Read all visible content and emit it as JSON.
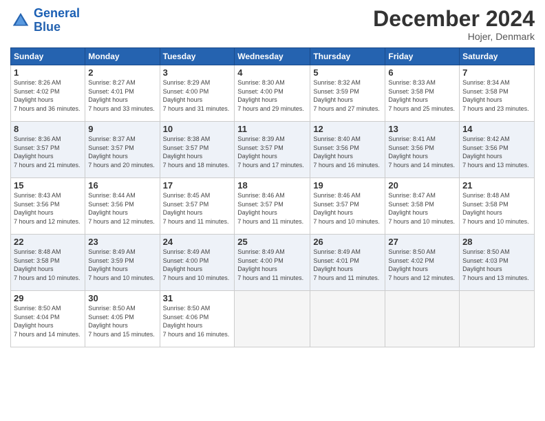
{
  "header": {
    "logo_line1": "General",
    "logo_line2": "Blue",
    "month_year": "December 2024",
    "location": "Hojer, Denmark"
  },
  "days_of_week": [
    "Sunday",
    "Monday",
    "Tuesday",
    "Wednesday",
    "Thursday",
    "Friday",
    "Saturday"
  ],
  "weeks": [
    [
      {
        "day": "1",
        "sunrise": "8:26 AM",
        "sunset": "4:02 PM",
        "daylight": "7 hours and 36 minutes."
      },
      {
        "day": "2",
        "sunrise": "8:27 AM",
        "sunset": "4:01 PM",
        "daylight": "7 hours and 33 minutes."
      },
      {
        "day": "3",
        "sunrise": "8:29 AM",
        "sunset": "4:00 PM",
        "daylight": "7 hours and 31 minutes."
      },
      {
        "day": "4",
        "sunrise": "8:30 AM",
        "sunset": "4:00 PM",
        "daylight": "7 hours and 29 minutes."
      },
      {
        "day": "5",
        "sunrise": "8:32 AM",
        "sunset": "3:59 PM",
        "daylight": "7 hours and 27 minutes."
      },
      {
        "day": "6",
        "sunrise": "8:33 AM",
        "sunset": "3:58 PM",
        "daylight": "7 hours and 25 minutes."
      },
      {
        "day": "7",
        "sunrise": "8:34 AM",
        "sunset": "3:58 PM",
        "daylight": "7 hours and 23 minutes."
      }
    ],
    [
      {
        "day": "8",
        "sunrise": "8:36 AM",
        "sunset": "3:57 PM",
        "daylight": "7 hours and 21 minutes."
      },
      {
        "day": "9",
        "sunrise": "8:37 AM",
        "sunset": "3:57 PM",
        "daylight": "7 hours and 20 minutes."
      },
      {
        "day": "10",
        "sunrise": "8:38 AM",
        "sunset": "3:57 PM",
        "daylight": "7 hours and 18 minutes."
      },
      {
        "day": "11",
        "sunrise": "8:39 AM",
        "sunset": "3:57 PM",
        "daylight": "7 hours and 17 minutes."
      },
      {
        "day": "12",
        "sunrise": "8:40 AM",
        "sunset": "3:56 PM",
        "daylight": "7 hours and 16 minutes."
      },
      {
        "day": "13",
        "sunrise": "8:41 AM",
        "sunset": "3:56 PM",
        "daylight": "7 hours and 14 minutes."
      },
      {
        "day": "14",
        "sunrise": "8:42 AM",
        "sunset": "3:56 PM",
        "daylight": "7 hours and 13 minutes."
      }
    ],
    [
      {
        "day": "15",
        "sunrise": "8:43 AM",
        "sunset": "3:56 PM",
        "daylight": "7 hours and 12 minutes."
      },
      {
        "day": "16",
        "sunrise": "8:44 AM",
        "sunset": "3:56 PM",
        "daylight": "7 hours and 12 minutes."
      },
      {
        "day": "17",
        "sunrise": "8:45 AM",
        "sunset": "3:57 PM",
        "daylight": "7 hours and 11 minutes."
      },
      {
        "day": "18",
        "sunrise": "8:46 AM",
        "sunset": "3:57 PM",
        "daylight": "7 hours and 11 minutes."
      },
      {
        "day": "19",
        "sunrise": "8:46 AM",
        "sunset": "3:57 PM",
        "daylight": "7 hours and 10 minutes."
      },
      {
        "day": "20",
        "sunrise": "8:47 AM",
        "sunset": "3:58 PM",
        "daylight": "7 hours and 10 minutes."
      },
      {
        "day": "21",
        "sunrise": "8:48 AM",
        "sunset": "3:58 PM",
        "daylight": "7 hours and 10 minutes."
      }
    ],
    [
      {
        "day": "22",
        "sunrise": "8:48 AM",
        "sunset": "3:58 PM",
        "daylight": "7 hours and 10 minutes."
      },
      {
        "day": "23",
        "sunrise": "8:49 AM",
        "sunset": "3:59 PM",
        "daylight": "7 hours and 10 minutes."
      },
      {
        "day": "24",
        "sunrise": "8:49 AM",
        "sunset": "4:00 PM",
        "daylight": "7 hours and 10 minutes."
      },
      {
        "day": "25",
        "sunrise": "8:49 AM",
        "sunset": "4:00 PM",
        "daylight": "7 hours and 11 minutes."
      },
      {
        "day": "26",
        "sunrise": "8:49 AM",
        "sunset": "4:01 PM",
        "daylight": "7 hours and 11 minutes."
      },
      {
        "day": "27",
        "sunrise": "8:50 AM",
        "sunset": "4:02 PM",
        "daylight": "7 hours and 12 minutes."
      },
      {
        "day": "28",
        "sunrise": "8:50 AM",
        "sunset": "4:03 PM",
        "daylight": "7 hours and 13 minutes."
      }
    ],
    [
      {
        "day": "29",
        "sunrise": "8:50 AM",
        "sunset": "4:04 PM",
        "daylight": "7 hours and 14 minutes."
      },
      {
        "day": "30",
        "sunrise": "8:50 AM",
        "sunset": "4:05 PM",
        "daylight": "7 hours and 15 minutes."
      },
      {
        "day": "31",
        "sunrise": "8:50 AM",
        "sunset": "4:06 PM",
        "daylight": "7 hours and 16 minutes."
      },
      null,
      null,
      null,
      null
    ]
  ]
}
